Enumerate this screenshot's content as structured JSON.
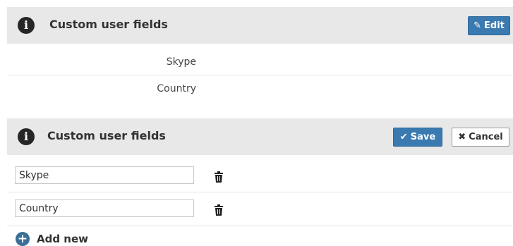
{
  "view_panel": {
    "title": "Custom user fields",
    "edit_label": "Edit",
    "fields": [
      "Skype",
      "Country"
    ]
  },
  "edit_panel": {
    "title": "Custom user fields",
    "save_label": "Save",
    "cancel_label": "Cancel",
    "fields": [
      {
        "value": "Skype"
      },
      {
        "value": "Country"
      }
    ],
    "add_new_label": "Add new"
  },
  "icons": {
    "info": "info-icon",
    "edit": "pencil-icon",
    "save": "check-icon",
    "cancel": "x-icon",
    "delete": "trash-icon",
    "add": "plus-circle-icon"
  },
  "colors": {
    "header_bg": "#e8e8e8",
    "primary_button": "#3a7ab1",
    "add_icon": "#3a6f97"
  }
}
